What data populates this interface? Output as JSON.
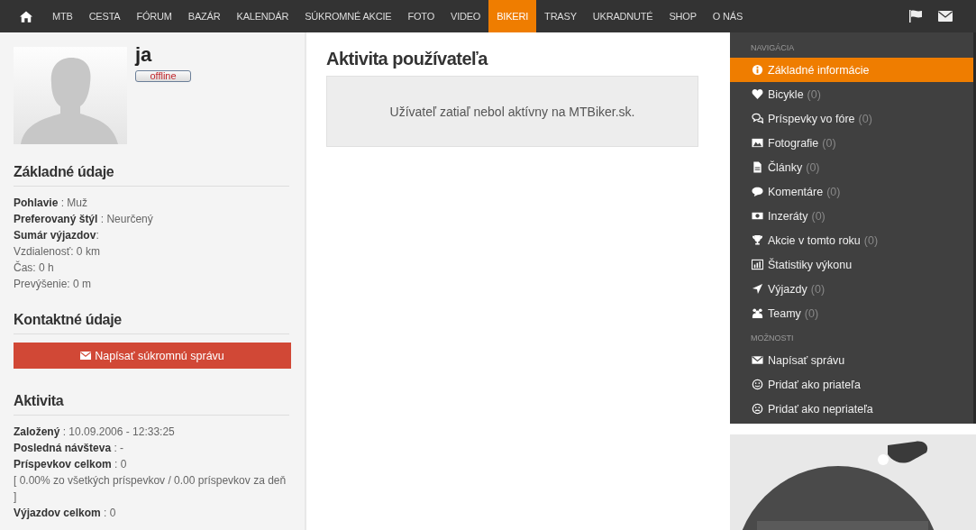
{
  "nav": {
    "items": [
      {
        "label": "MTB",
        "selected": false
      },
      {
        "label": "CESTA",
        "selected": false
      },
      {
        "label": "FÓRUM",
        "selected": false
      },
      {
        "label": "BAZÁR",
        "selected": false
      },
      {
        "label": "KALENDÁR",
        "selected": false
      },
      {
        "label": "SÚKROMNÉ AKCIE",
        "selected": false
      },
      {
        "label": "FOTO",
        "selected": false
      },
      {
        "label": "VIDEO",
        "selected": false
      },
      {
        "label": "BIKERI",
        "selected": true
      },
      {
        "label": "TRASY",
        "selected": false
      },
      {
        "label": "UKRADNUTÉ",
        "selected": false
      },
      {
        "label": "SHOP",
        "selected": false
      },
      {
        "label": "O NÁS",
        "selected": false
      }
    ]
  },
  "profile": {
    "username": "ja",
    "status": "offline"
  },
  "sections": [
    {
      "title": "Základné údaje",
      "lines": [
        "**Pohlavie** : Muž",
        "**Preferovaný štýl** : Neurčený",
        "**Sumár výjazdov**:",
        "Vzdialenosť: 0 km",
        "Čas: 0 h",
        "Prevýšenie: 0 m"
      ]
    },
    {
      "title": "Kontaktné údaje",
      "button": "Napísať súkromnú správu"
    },
    {
      "title": "Aktivita",
      "lines": [
        "**Založený** : 10.09.2006 - 12:33:25",
        "**Posledná návšteva** : -",
        "**Príspevkov celkom** : 0",
        "[ 0.00% zo všetkých príspevkov / 0.00 príspevkov za deň ]",
        "**Výjazdov celkom** : 0"
      ]
    }
  ],
  "main": {
    "title": "Aktivita používateľa",
    "message": "Užívateľ zatiaľ nebol aktívny na MTBiker.sk."
  },
  "sidebar": {
    "groups": [
      {
        "heading": "NAVIGÁCIA",
        "items": [
          {
            "label": "Základné informácie",
            "selected": true
          },
          {
            "label": "Bicykle",
            "count": "(0)",
            "selected": false
          },
          {
            "label": "Príspevky vo fóre",
            "count": "(0)",
            "selected": false
          },
          {
            "label": "Fotografie",
            "count": "(0)",
            "selected": false
          },
          {
            "label": "Články",
            "count": "(0)",
            "selected": false
          },
          {
            "label": "Komentáre",
            "count": "(0)",
            "selected": false
          },
          {
            "label": "Inzeráty",
            "count": "(0)",
            "selected": false
          },
          {
            "label": "Akcie v tomto roku",
            "count": "(0)",
            "selected": false
          },
          {
            "label": "Štatistiky výkonu",
            "selected": false
          },
          {
            "label": "Výjazdy",
            "count": "(0)",
            "selected": false
          },
          {
            "label": "Teamy",
            "count": "(0)",
            "selected": false
          }
        ]
      },
      {
        "heading": "MOŽNOSTI",
        "items": [
          {
            "label": "Napísať správu",
            "selected": false
          },
          {
            "label": "Pridať ako priateľa",
            "selected": false
          },
          {
            "label": "Pridať ako nepriateľa",
            "selected": false
          }
        ]
      }
    ]
  }
}
